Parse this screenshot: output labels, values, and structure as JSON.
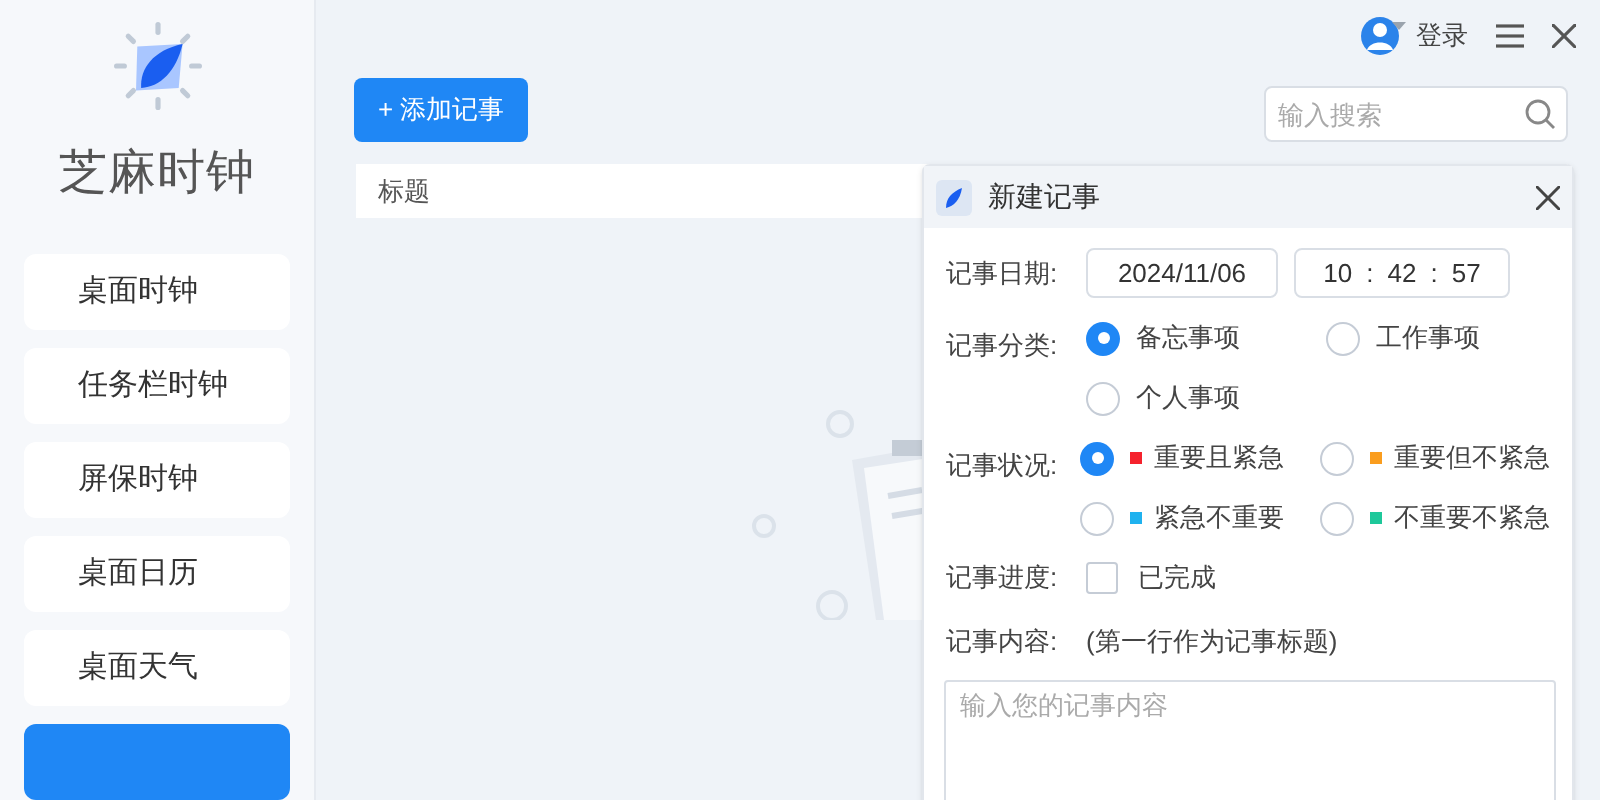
{
  "app": {
    "title": "芝麻时钟"
  },
  "sidebar": {
    "items": [
      {
        "label": "桌面时钟",
        "selected": false
      },
      {
        "label": "任务栏时钟",
        "selected": false
      },
      {
        "label": "屏保时钟",
        "selected": false
      },
      {
        "label": "桌面日历",
        "selected": false
      },
      {
        "label": "桌面天气",
        "selected": false
      },
      {
        "selected": true
      }
    ]
  },
  "header": {
    "login": "登录"
  },
  "toolbar": {
    "add_button": "+ 添加记事",
    "search": {
      "placeholder": "输入搜索"
    }
  },
  "table": {
    "columns": [
      "标题"
    ]
  },
  "dialog": {
    "title": "新建记事",
    "date": {
      "label": "记事日期:",
      "date": "2024/11/06",
      "hour": "10",
      "minute": "42",
      "second": "57",
      "separator": ":"
    },
    "category": {
      "label": "记事分类:",
      "options": [
        {
          "label": "备忘事项",
          "selected": true
        },
        {
          "label": "工作事项",
          "selected": false
        },
        {
          "label": "个人事项",
          "selected": false
        }
      ]
    },
    "status": {
      "label": "记事状况:",
      "options": [
        {
          "label": "重要且紧急",
          "selected": true,
          "color": "#f5222d"
        },
        {
          "label": "重要但不紧急",
          "selected": false,
          "color": "#fa9d1e"
        },
        {
          "label": "紧急不重要",
          "selected": false,
          "color": "#1fb2ef"
        },
        {
          "label": "不重要不紧急",
          "selected": false,
          "color": "#1ec89a"
        }
      ]
    },
    "progress": {
      "label": "记事进度:",
      "option": "已完成",
      "checked": false
    },
    "content": {
      "label": "记事内容:",
      "hint": "(第一行作为记事标题)",
      "placeholder": "输入您的记事内容"
    }
  }
}
